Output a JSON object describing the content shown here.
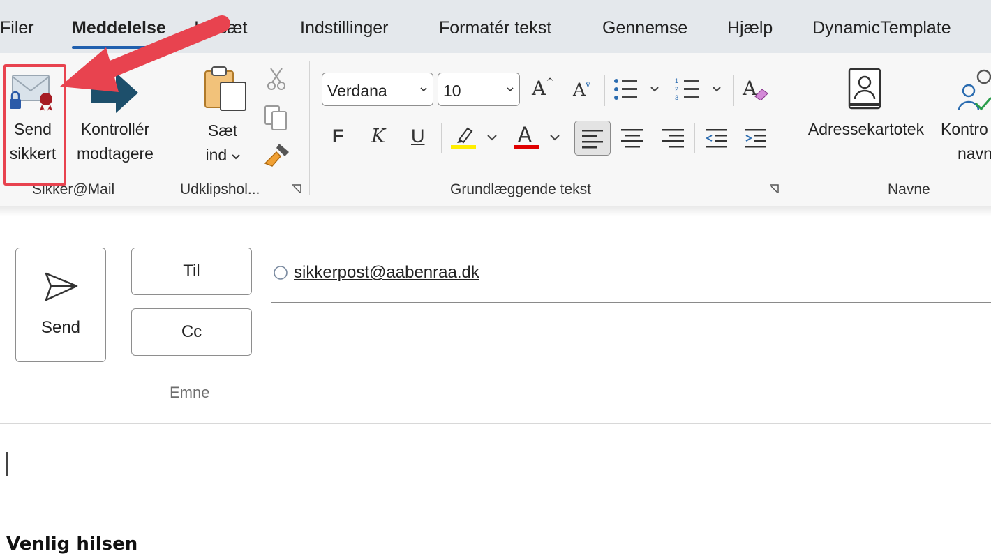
{
  "tabs": [
    {
      "label": "Filer"
    },
    {
      "label": "Meddelelse"
    },
    {
      "label": "Indsæt"
    },
    {
      "label": "Indstillinger"
    },
    {
      "label": "Formatér tekst"
    },
    {
      "label": "Gennemse"
    },
    {
      "label": "Hjælp"
    },
    {
      "label": "DynamicTemplate"
    }
  ],
  "ribbon": {
    "sikker_mail": {
      "group_label": "Sikker@Mail",
      "send_secure_label_1": "Send",
      "send_secure_label_2": "sikkert",
      "check_recipients_label_1": "Kontrollér",
      "check_recipients_label_2": "modtagere"
    },
    "clipboard": {
      "group_label": "Udklipshol...",
      "paste_label_1": "Sæt",
      "paste_label_2": "ind"
    },
    "basic_text": {
      "group_label": "Grundlæggende tekst",
      "font_name": "Verdana",
      "font_size": "10",
      "bold_glyph": "F",
      "italic_glyph": "K",
      "underline_glyph": "U",
      "font_color_glyph": "A",
      "grow_glyph": "A",
      "shrink_glyph": "A",
      "clear_glyph": "A",
      "highlight_color": "#ffee00",
      "font_color": "#e00000"
    },
    "names": {
      "group_label": "Navne",
      "address_book_label": "Adressekartotek",
      "check_names_label_1": "Kontro",
      "check_names_label_2": "navn"
    }
  },
  "compose": {
    "send_label": "Send",
    "to_label": "Til",
    "cc_label": "Cc",
    "subject_label": "Emne",
    "to_recipient": "sikkerpost@aabenraa.dk",
    "signature": "Venlig hilsen"
  },
  "colors": {
    "accent": "#1f5fae",
    "annotation": "#e8434f",
    "send_arrow": "#1d4f6b"
  }
}
